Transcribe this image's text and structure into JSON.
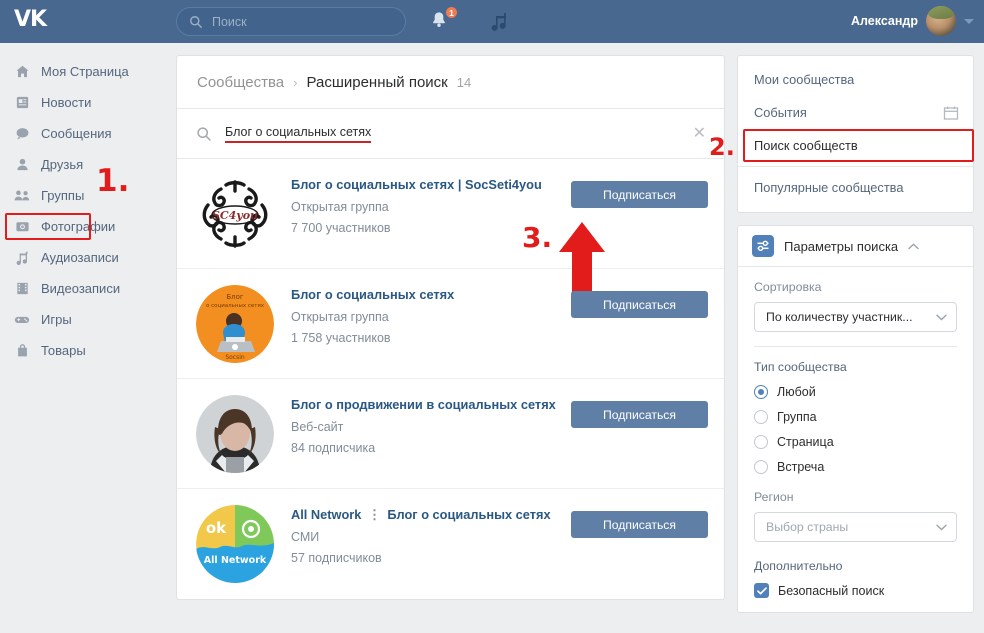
{
  "topbar": {
    "logo": "VK",
    "search_placeholder": "Поиск",
    "search_icon": "search-icon",
    "bell_icon": "notifications-bell-icon",
    "bell_badge": "1",
    "music_icon": "music-note-icon",
    "user_name": "Александр",
    "avatar_alt": "user-avatar",
    "chevron": "chevron-down-icon",
    "bg_color": "#48688f"
  },
  "sidebar": {
    "items": [
      {
        "label": "Моя Страница",
        "icon": "home-icon"
      },
      {
        "label": "Новости",
        "icon": "news-icon"
      },
      {
        "label": "Сообщения",
        "icon": "message-bubble-icon"
      },
      {
        "label": "Друзья",
        "icon": "person-icon"
      },
      {
        "label": "Группы",
        "icon": "people-group-icon"
      },
      {
        "label": "Фотографии",
        "icon": "camera-icon"
      },
      {
        "label": "Аудиозаписи",
        "icon": "music-note-icon"
      },
      {
        "label": "Видеозаписи",
        "icon": "film-strip-icon"
      },
      {
        "label": "Игры",
        "icon": "gamepad-icon"
      },
      {
        "label": "Товары",
        "icon": "bag-icon"
      }
    ]
  },
  "annotations": {
    "step1": "1.",
    "step2": "2.",
    "step3": "3.",
    "color": "#e21b1b"
  },
  "center": {
    "breadcrumb": {
      "root": "Сообщества",
      "separator": "›",
      "current": "Расширенный поиск",
      "count": "14"
    },
    "search": {
      "icon": "search-icon",
      "value": "Блог о социальных сетях",
      "clear_icon": "close-icon",
      "clear_glyph": "✕"
    },
    "results": [
      {
        "title": "Блог о социальных сетях | SocSeti4you",
        "subtitle": "Открытая группа",
        "count": "7 700 участников",
        "button": "Подписаться",
        "avatar": "socseti4you-ornament-logo"
      },
      {
        "title": "Блог о социальных сетях",
        "subtitle": "Открытая группа",
        "count": "1 758 участников",
        "button": "Подписаться",
        "avatar": "orange-blogger-illustration"
      },
      {
        "title": "Блог о продвижении в социальных сетях",
        "subtitle": "Веб-сайт",
        "count": "84 подписчика",
        "button": "Подписаться",
        "avatar": "person-photo"
      },
      {
        "title_prefix": "All Network",
        "title_divider": "⋮",
        "title_rest": "Блог о социальных сетях",
        "title": "All Network ⋮ Блог о социальных сетях",
        "subtitle": "СМИ",
        "count": "57 подписчиков",
        "button": "Подписаться",
        "avatar": "all-network-logo"
      }
    ]
  },
  "right": {
    "menu": [
      {
        "label": "Мои сообщества",
        "icon": ""
      },
      {
        "label": "События",
        "icon": "calendar-icon"
      },
      {
        "label": "Поиск сообществ",
        "icon": "",
        "active": true
      },
      {
        "label": "Популярные сообщества",
        "icon": ""
      }
    ],
    "params": {
      "icon": "sliders-icon",
      "title": "Параметры поиска",
      "collapse_icon": "chevron-up-icon",
      "sort_label": "Сортировка",
      "sort_value": "По количеству участник...",
      "sort_chevron": "chevron-down-icon",
      "type_label": "Тип сообщества",
      "type_options": [
        {
          "label": "Любой",
          "selected": true
        },
        {
          "label": "Группа",
          "selected": false
        },
        {
          "label": "Страница",
          "selected": false
        },
        {
          "label": "Встреча",
          "selected": false
        }
      ],
      "region_label": "Регион",
      "region_placeholder": "Выбор страны",
      "region_chevron": "chevron-down-icon",
      "extra_label": "Дополнительно",
      "safe_search_label": "Безопасный поиск",
      "safe_search_checked": true,
      "check_glyph": "✓"
    }
  },
  "colors": {
    "accent_blue": "#5181b8",
    "button_blue": "#5f7fa6",
    "topbar": "#48688f",
    "annotation_red": "#e21b1b",
    "link_blue": "#2a5885",
    "muted_text": "#818c99"
  }
}
